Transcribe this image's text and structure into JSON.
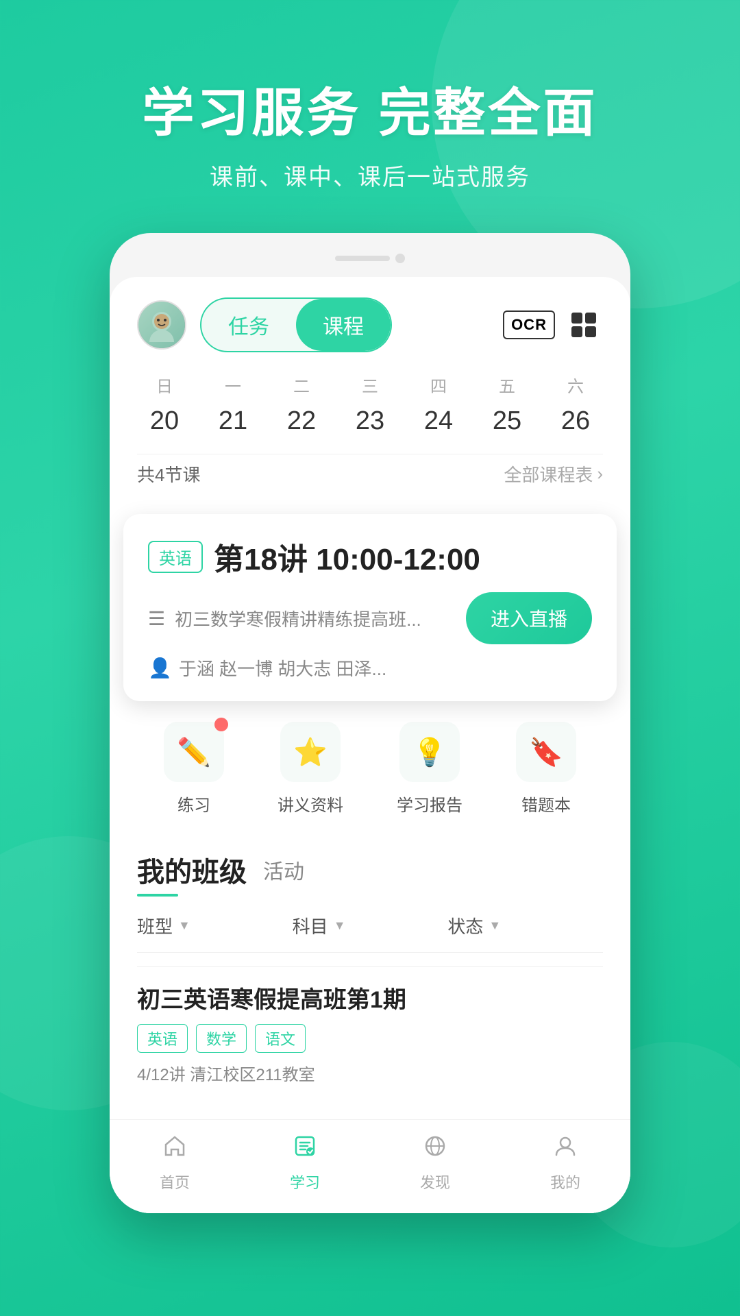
{
  "hero": {
    "title": "学习服务  完整全面",
    "subtitle": "课前、课中、课后一站式服务"
  },
  "app": {
    "tabs": [
      {
        "id": "task",
        "label": "任务",
        "active": false
      },
      {
        "id": "course",
        "label": "课程",
        "active": true
      }
    ],
    "ocr_label": "OCR",
    "week_days": [
      "日",
      "一",
      "二",
      "三",
      "四",
      "五",
      "六"
    ],
    "week_dates": [
      {
        "num": "20",
        "active": false
      },
      {
        "num": "21",
        "active": false
      },
      {
        "num": "22",
        "active": true
      },
      {
        "num": "23",
        "active": false
      },
      {
        "num": "24",
        "active": false
      },
      {
        "num": "25",
        "active": false
      },
      {
        "num": "26",
        "active": false
      }
    ],
    "course_count": "共4节课",
    "all_schedule": "全部课程表",
    "course_card": {
      "subject_tag": "英语",
      "title": "第18讲 10:00-12:00",
      "course_name": "初三数学寒假精讲精练提高班...",
      "teachers": "于涵  赵一博  胡大志  田泽...",
      "enter_btn": "进入直播"
    },
    "quick_actions": [
      {
        "id": "exercise",
        "label": "练习",
        "icon": "✏️",
        "has_badge": true
      },
      {
        "id": "materials",
        "label": "讲义资料",
        "icon": "⭐",
        "has_badge": false
      },
      {
        "id": "report",
        "label": "学习报告",
        "icon": "💡",
        "has_badge": false
      },
      {
        "id": "mistakes",
        "label": "错题本",
        "icon": "🔖",
        "has_badge": false
      }
    ],
    "my_class": {
      "title": "我的班级",
      "tab": "活动",
      "filters": [
        {
          "label": "班型"
        },
        {
          "label": "科目"
        },
        {
          "label": "状态"
        }
      ],
      "classes": [
        {
          "name": "初三英语寒假提高班第1期",
          "tags": [
            "英语",
            "数学",
            "语文"
          ],
          "meta": "4/12讲  清江校区211教室"
        }
      ]
    },
    "bottom_nav": [
      {
        "id": "home",
        "label": "首页",
        "icon": "🏠",
        "active": false
      },
      {
        "id": "study",
        "label": "学习",
        "icon": "📋",
        "active": true
      },
      {
        "id": "discover",
        "label": "发现",
        "icon": "🌐",
        "active": false
      },
      {
        "id": "profile",
        "label": "我的",
        "icon": "👤",
        "active": false
      }
    ]
  }
}
